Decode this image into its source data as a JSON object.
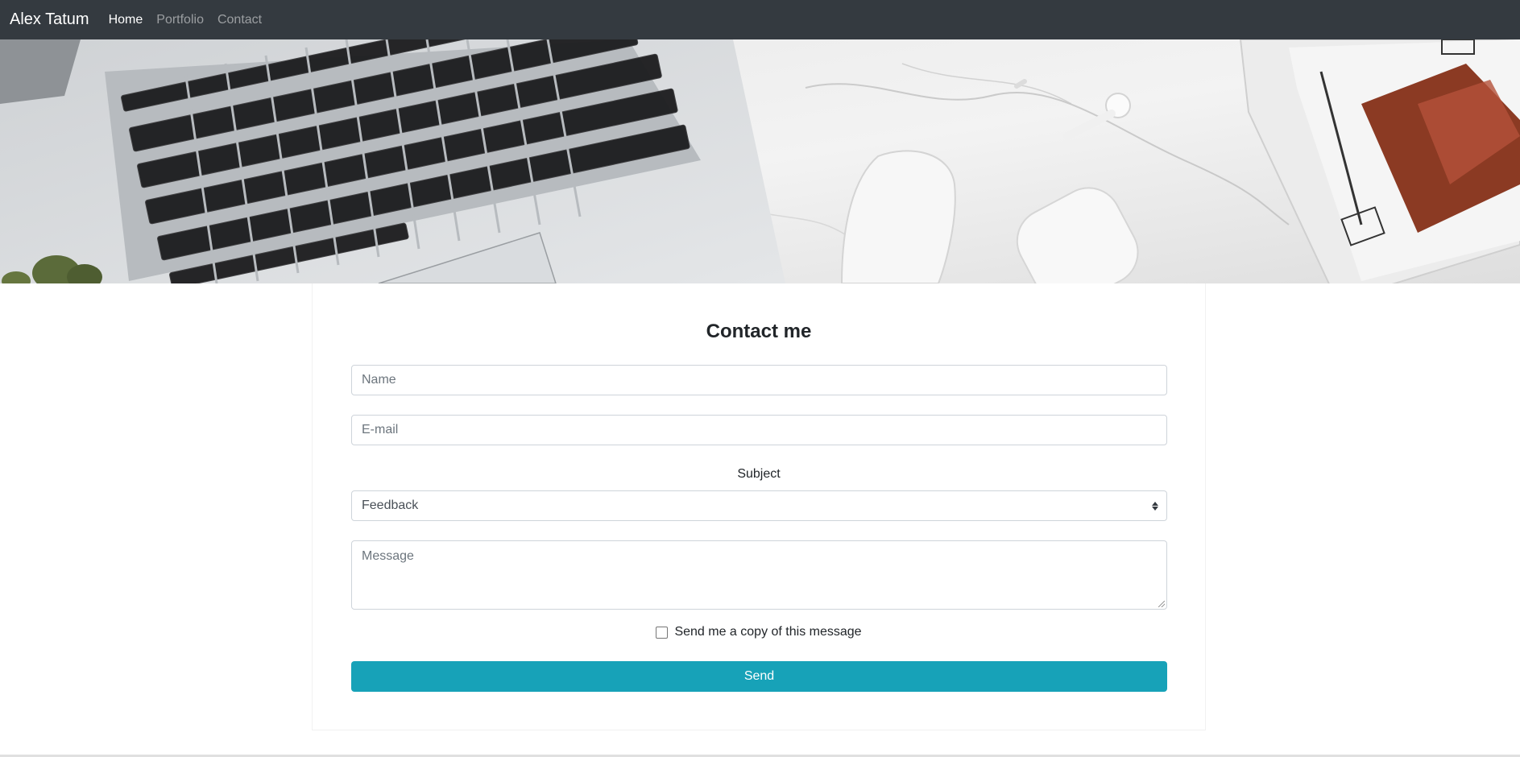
{
  "navbar": {
    "brand": "Alex Tatum",
    "links": [
      {
        "label": "Home",
        "active": true
      },
      {
        "label": "Portfolio",
        "active": false
      },
      {
        "label": "Contact",
        "active": false
      }
    ]
  },
  "hero": {
    "image": "desk-flatlay-laptop-mouse-earbuds-newspaper"
  },
  "form": {
    "title": "Contact me",
    "name_placeholder": "Name",
    "email_placeholder": "E-mail",
    "subject_label": "Subject",
    "subject_selected": "Feedback",
    "message_placeholder": "Message",
    "copy_label": "Send me a copy of this message",
    "copy_checked": false,
    "send_label": "Send"
  },
  "colors": {
    "navbar_bg": "#343a40",
    "accent": "#17a2b8"
  }
}
